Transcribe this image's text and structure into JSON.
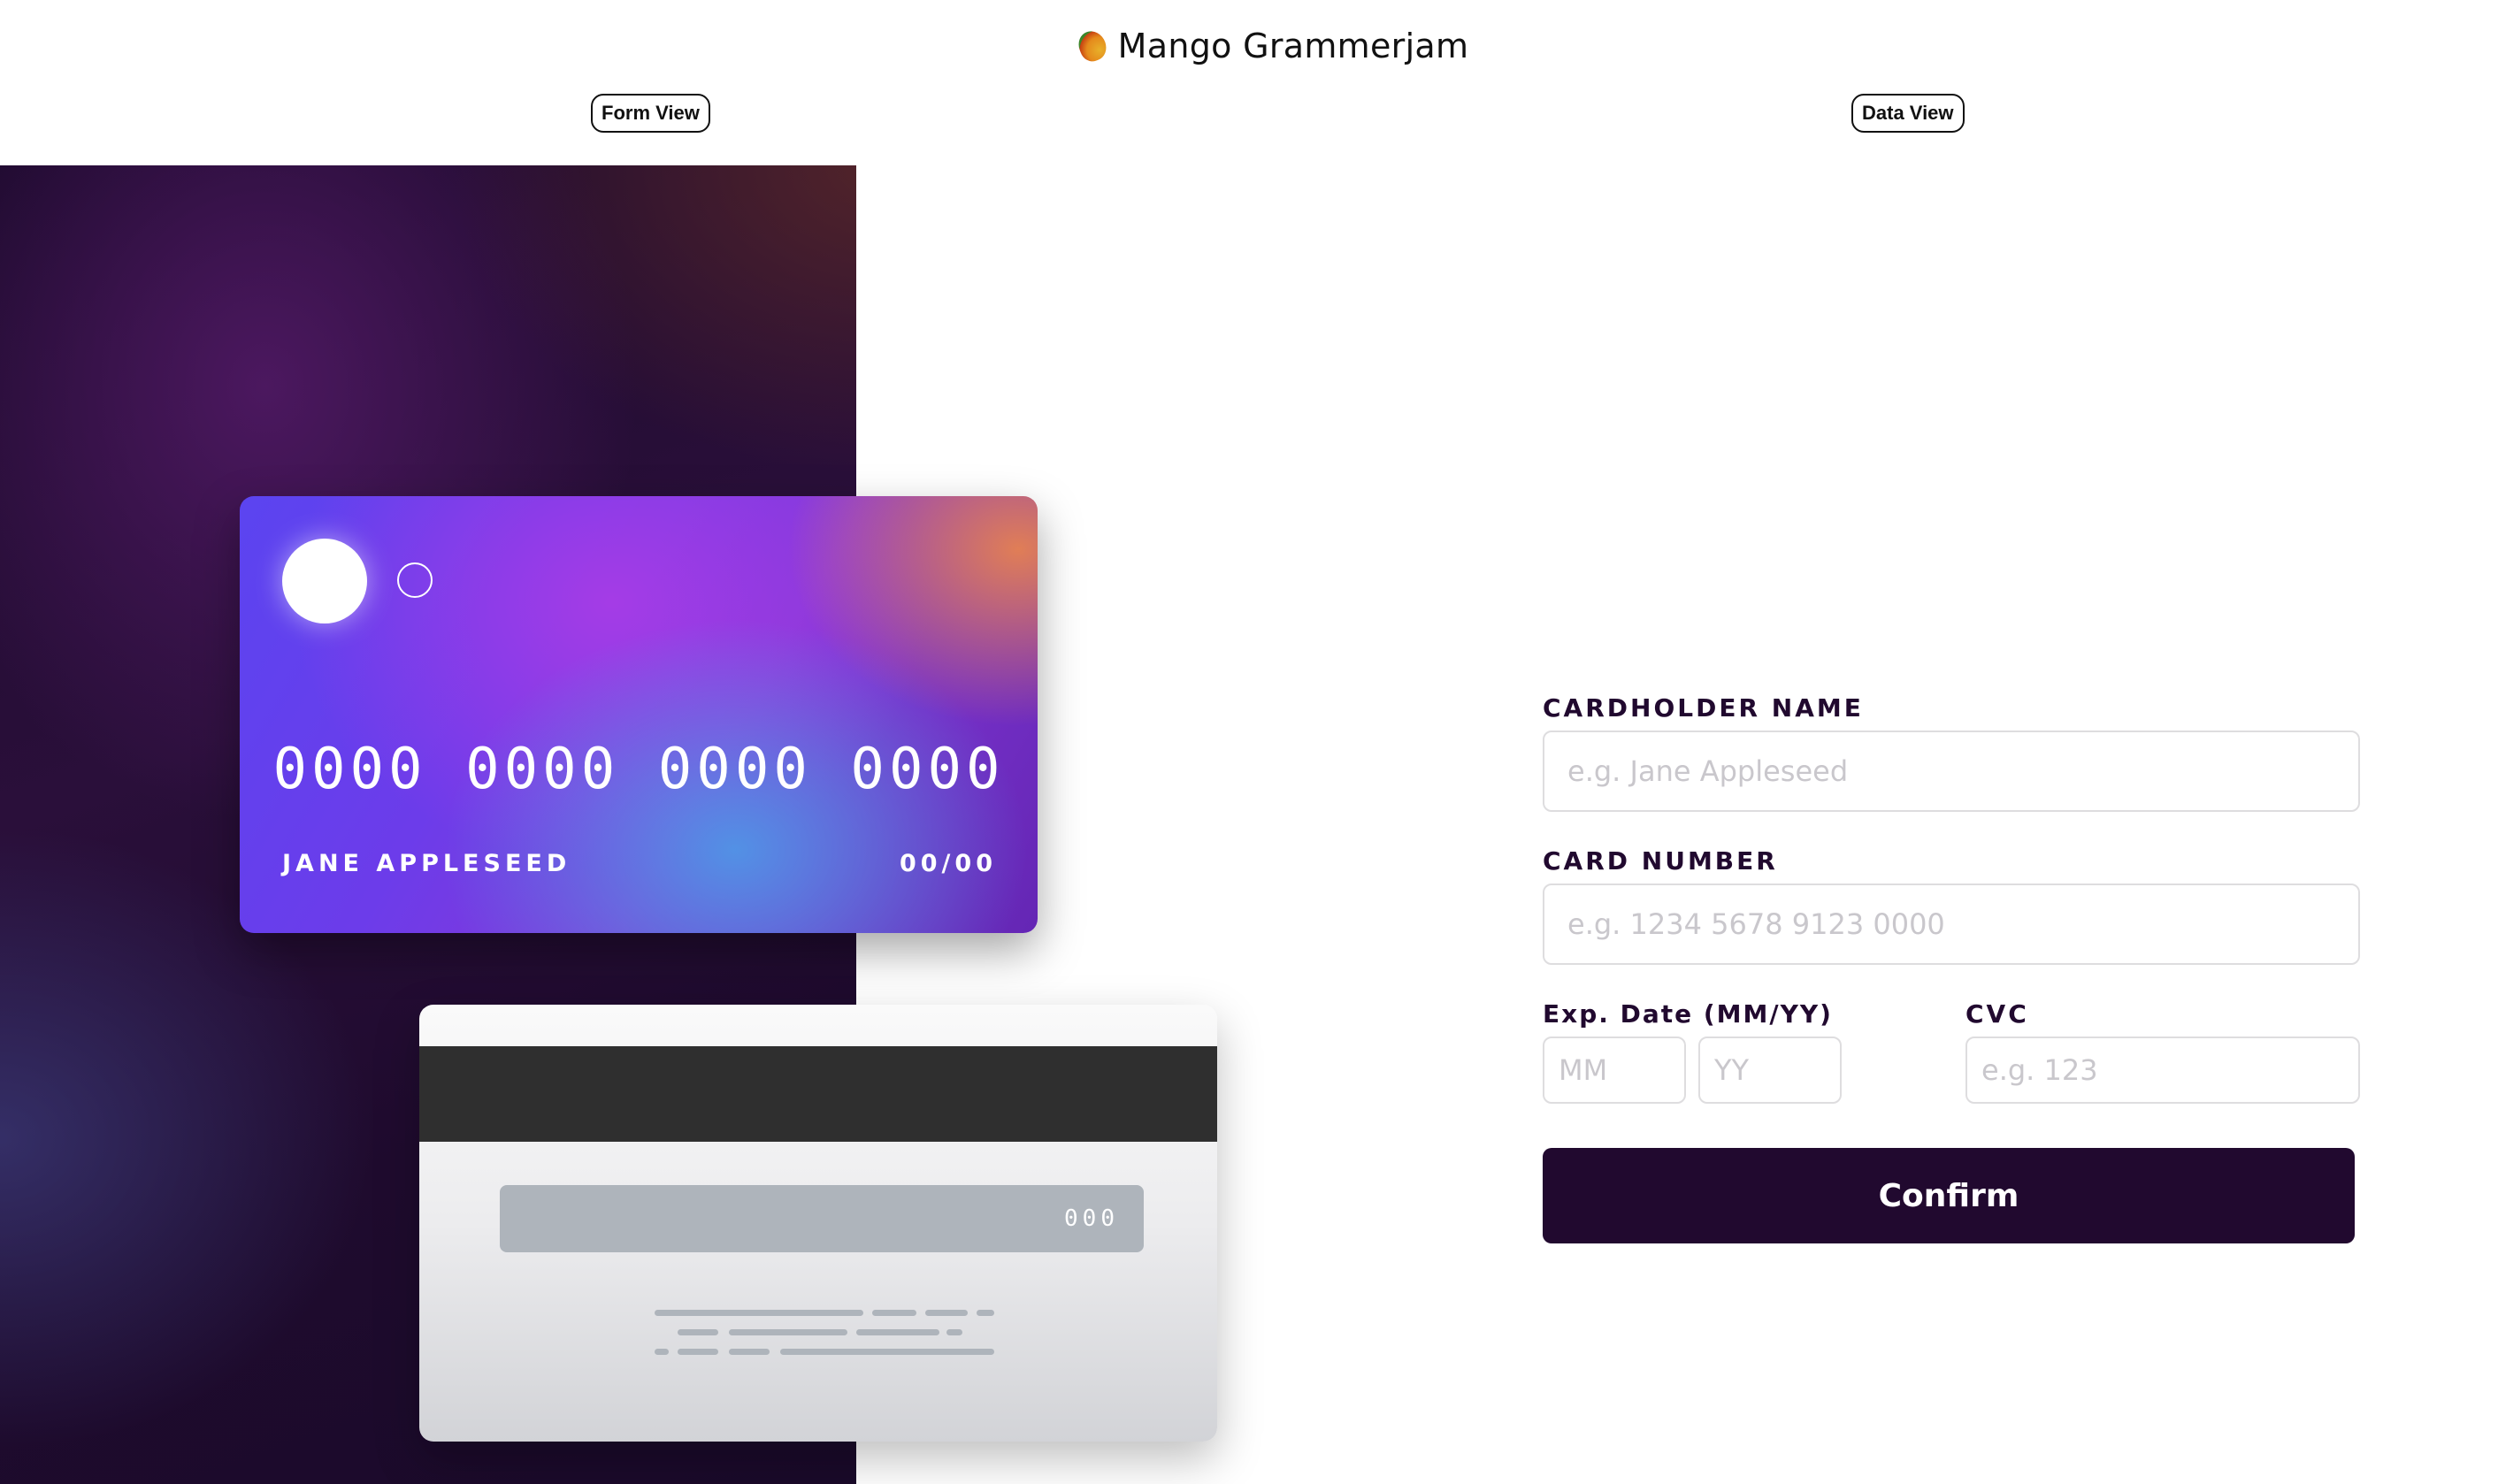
{
  "header": {
    "logo_icon": "mango-icon",
    "title": "Mango Grammerjam"
  },
  "view_toggle": {
    "form_view": "Form View",
    "data_view": "Data View"
  },
  "card_front": {
    "number": "0000 0000 0000 0000",
    "name": "JANE APPLESEED",
    "expiry": "00/00"
  },
  "card_back": {
    "cvc": "000"
  },
  "form": {
    "cardholder_name": {
      "label": "CARDHOLDER NAME",
      "placeholder": "e.g. Jane Appleseed",
      "value": ""
    },
    "card_number": {
      "label": "CARD NUMBER",
      "placeholder": "e.g. 1234 5678 9123 0000",
      "value": ""
    },
    "exp_date": {
      "label": "Exp. Date (MM/YY)",
      "month_placeholder": "MM",
      "year_placeholder": "YY"
    },
    "cvc": {
      "label": "CVC",
      "placeholder": "e.g. 123",
      "value": ""
    },
    "confirm_label": "Confirm"
  },
  "colors": {
    "primary_dark": "#21092f",
    "input_border": "#dedddf",
    "placeholder": "#c9c7cc"
  }
}
